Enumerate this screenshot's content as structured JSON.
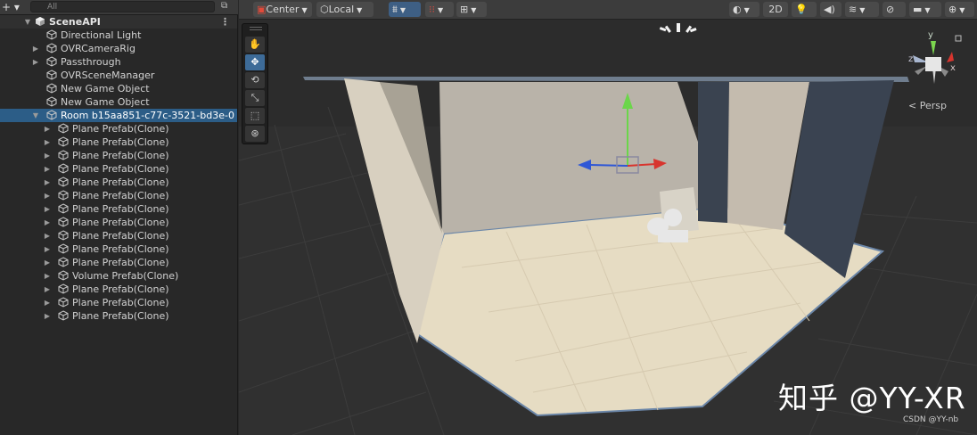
{
  "hierarchy": {
    "add_label": "+ ▾",
    "search_placeholder": "All",
    "scene_name": "SceneAPI",
    "items": [
      {
        "label": "Directional Light"
      },
      {
        "label": "OVRCameraRig"
      },
      {
        "label": "Passthrough"
      },
      {
        "label": "OVRSceneManager"
      },
      {
        "label": "New Game Object"
      },
      {
        "label": "New Game Object"
      },
      {
        "label": "Room b15aa851-c77c-3521-bd3e-0"
      },
      {
        "label": "Plane Prefab(Clone)"
      },
      {
        "label": "Plane Prefab(Clone)"
      },
      {
        "label": "Plane Prefab(Clone)"
      },
      {
        "label": "Plane Prefab(Clone)"
      },
      {
        "label": "Plane Prefab(Clone)"
      },
      {
        "label": "Plane Prefab(Clone)"
      },
      {
        "label": "Plane Prefab(Clone)"
      },
      {
        "label": "Plane Prefab(Clone)"
      },
      {
        "label": "Plane Prefab(Clone)"
      },
      {
        "label": "Plane Prefab(Clone)"
      },
      {
        "label": "Plane Prefab(Clone)"
      },
      {
        "label": "Volume Prefab(Clone)"
      },
      {
        "label": "Plane Prefab(Clone)"
      },
      {
        "label": "Plane Prefab(Clone)"
      },
      {
        "label": "Plane Prefab(Clone)"
      }
    ]
  },
  "scene_toolbar": {
    "pivot_mode": "Center",
    "pivot_rotation": "Local",
    "mode_2d": "2D"
  },
  "gizmo": {
    "axis_y": "y",
    "axis_z": "z",
    "axis_x": "x",
    "projection": "< Persp"
  },
  "overlay": {
    "watermark": "知乎 @YY-XR",
    "credit": "CSDN @YY-nb"
  },
  "colors": {
    "selection": "#2c5d87",
    "active_tool": "#3d6b98",
    "floor": "#e6dcc3",
    "wall": "#b9b3a9"
  }
}
